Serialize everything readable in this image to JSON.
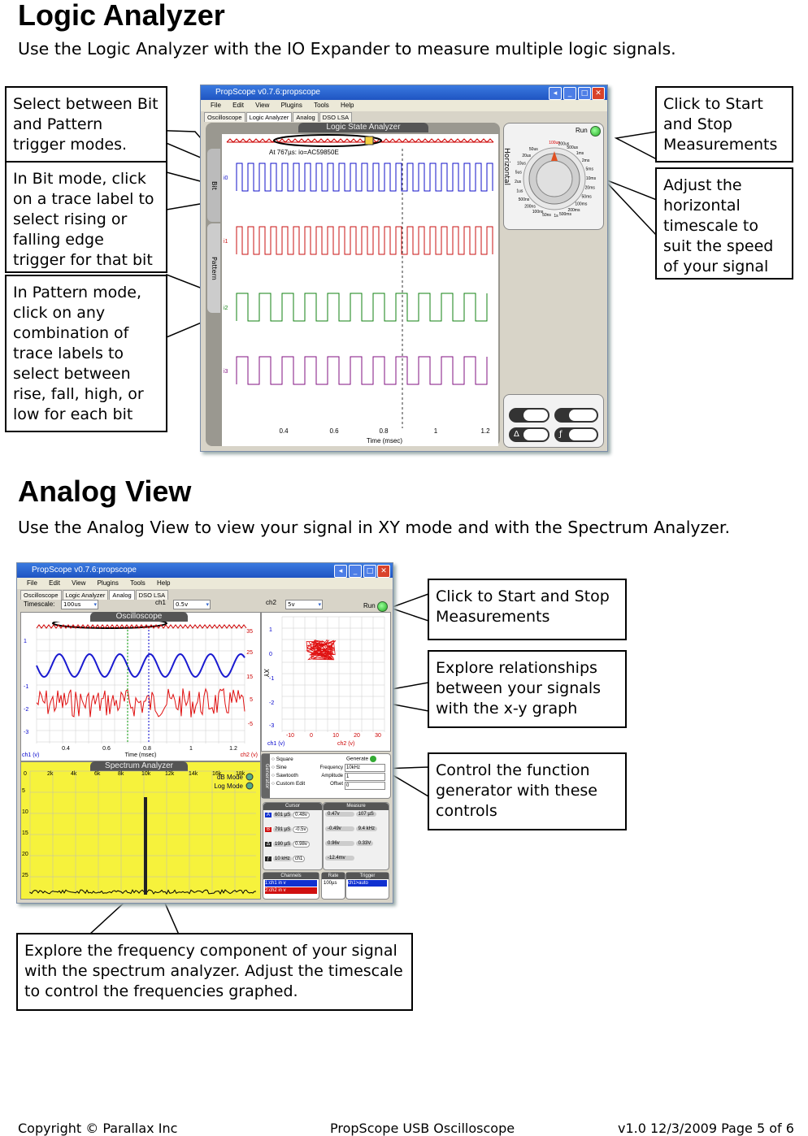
{
  "logic": {
    "title": "Logic Analyzer",
    "subtitle": "Use the Logic Analyzer with the IO Expander to measure multiple logic signals.",
    "callouts": {
      "bit_pattern": "Select between Bit and Pattern trigger modes.",
      "bit_mode": "In Bit mode, click on a trace label to select rising or falling edge trigger for that bit",
      "pattern_mode": "In Pattern mode, click on any combination of trace labels to select between rise, fall, high, or low for each bit",
      "start_stop": "Click to Start and Stop Measurements",
      "timescale": "Adjust the horizontal timescale to suit the speed of your signal"
    },
    "window": {
      "title": "PropScope v0.7.6:propscope",
      "menu": [
        "File",
        "Edit",
        "View",
        "Plugins",
        "Tools",
        "Help"
      ],
      "tabs": [
        "Oscilloscope",
        "Logic Analyzer",
        "Analog",
        "DSO LSA"
      ],
      "panel_title": "Logic State Analyzer",
      "readout": "At 767µs:  io=AC59850E",
      "side_tabs": [
        "Bit",
        "Pattern"
      ],
      "trace_labels": [
        "i0",
        "i1",
        "i2",
        "i3"
      ],
      "trace_colors": [
        "#1010c8",
        "#c81010",
        "#108010",
        "#801080"
      ],
      "x_ticks": [
        "0.4",
        "0.6",
        "0.8",
        "1",
        "1.2"
      ],
      "x_label": "Time (msec)",
      "run_label": "Run",
      "horizontal_label": "Horizontal",
      "dial_labels": [
        "100us",
        "200us",
        "500us",
        "1ms",
        "2ms",
        "5ms",
        "10ms",
        "20ms",
        "50ms",
        "100ms",
        "200ms",
        "500ms",
        "1s",
        "50ns",
        "100ns",
        "200ns",
        "500ns",
        "1us",
        "2us",
        "5us",
        "10us",
        "20us",
        "50us"
      ],
      "delta_symbol": "Δ",
      "f_symbol": "ƒ"
    }
  },
  "analog": {
    "title": "Analog View",
    "subtitle": "Use the Analog View to view your signal in XY mode and with the Spectrum Analyzer.",
    "callouts": {
      "start_stop": "Click to Start and Stop Measurements",
      "xy": "Explore relationships between your signals with the x-y graph",
      "generator": "Control the function generator with these controls",
      "spectrum": "Explore the frequency component of your signal with the spectrum analyzer.  Adjust the timescale to control the frequencies graphed."
    },
    "window": {
      "title": "PropScope v0.7.6:propscope",
      "menu": [
        "File",
        "Edit",
        "View",
        "Plugins",
        "Tools",
        "Help"
      ],
      "tabs": [
        "Oscilloscope",
        "Logic Analyzer",
        "Analog",
        "DSO LSA"
      ],
      "timescale_label": "Timescale:",
      "timescale_value": "100us",
      "ch1_label": "ch1",
      "ch1_value": "0.5v",
      "ch2_label": "ch2",
      "ch2_value": "5v",
      "run_label": "Run",
      "scope_title": "Oscilloscope",
      "scope_left_ticks": [
        "1",
        "-1",
        "-2",
        "-3"
      ],
      "scope_right_ticks": [
        "35",
        "25",
        "15",
        "5",
        "-5"
      ],
      "scope_x_ticks": [
        "0.4",
        "0.6",
        "0.8",
        "1",
        "1.2"
      ],
      "scope_x_label": "Time (msec)",
      "ch1_axis": "ch1 (v)",
      "ch2_axis": "ch2 (v)",
      "xy_label": "XY",
      "xy_y_ticks": [
        "1",
        "0",
        "-1",
        "-2",
        "-3"
      ],
      "xy_x_ticks": [
        "-10",
        "0",
        "10",
        "20",
        "30"
      ],
      "spectrum_title": "Spectrum Analyzer",
      "spectrum_x_ticks": [
        "0",
        "2k",
        "4k",
        "6k",
        "8k",
        "10k",
        "12k",
        "14k",
        "16k",
        "18k"
      ],
      "spectrum_y_ticks": [
        "0",
        "5",
        "10",
        "15",
        "20",
        "25"
      ],
      "db_mode": "dB Mode",
      "log_mode": "Log Mode",
      "generator_label": "Generator",
      "waveforms": [
        "Square",
        "Sine",
        "Sawtooth",
        "Custom"
      ],
      "edit_label": "Edit",
      "generate_label": "Generate",
      "gen_fields": [
        {
          "label": "Frequency",
          "value": "10kHz"
        },
        {
          "label": "Amplitude",
          "value": "1"
        },
        {
          "label": "Offset",
          "value": "0"
        }
      ],
      "cursor_title": "Cursor",
      "cursor_rows": [
        {
          "key": "A",
          "time": "601 µS",
          "val": "0.48v"
        },
        {
          "key": "B",
          "time": "791 µS",
          "val": "-0.5v"
        },
        {
          "key": "Δ",
          "time": "190 µS",
          "val": "0.98v"
        },
        {
          "key": "ƒ",
          "time": "10 kHz",
          "val": "ch1"
        }
      ],
      "measure_title": "Measure",
      "measure_rows": [
        [
          "0.47v",
          "107 µS"
        ],
        [
          "-0.49v",
          "9.4 kHz"
        ],
        [
          "0.96v",
          "0.33V"
        ],
        [
          "-12.4mv",
          ""
        ]
      ],
      "channels_title": "Channels",
      "channels": [
        "1:ch1 in v",
        "2:ch2 in v"
      ],
      "rate_title": "Rate",
      "rate_value": "100µs",
      "trigger_title": "Trigger",
      "trigger_value": "ch1>auto"
    }
  },
  "footer": {
    "left": "Copyright © Parallax Inc",
    "center": "PropScope USB Oscilloscope",
    "right": "v1.0  12/3/2009  Page 5 of 6"
  }
}
